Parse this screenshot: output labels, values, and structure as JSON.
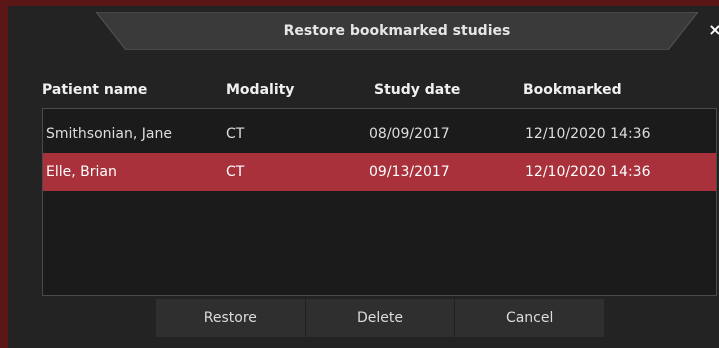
{
  "dialog": {
    "title": "Restore bookmarked studies",
    "close_glyph": "×"
  },
  "columns": {
    "patient_name": "Patient name",
    "modality": "Modality",
    "study_date": "Study date",
    "bookmarked": "Bookmarked"
  },
  "rows": [
    {
      "patient_name": "Smithsonian, Jane",
      "modality": "CT",
      "study_date": "08/09/2017",
      "bookmarked": "12/10/2020 14:36",
      "selected": false
    },
    {
      "patient_name": "Elle, Brian",
      "modality": "CT",
      "study_date": "09/13/2017",
      "bookmarked": "12/10/2020 14:36",
      "selected": true
    }
  ],
  "buttons": {
    "restore": "Restore",
    "delete": "Delete",
    "cancel": "Cancel"
  },
  "colors": {
    "selection": "#a8313c",
    "frame_border": "#5a1515",
    "background": "#232323"
  }
}
